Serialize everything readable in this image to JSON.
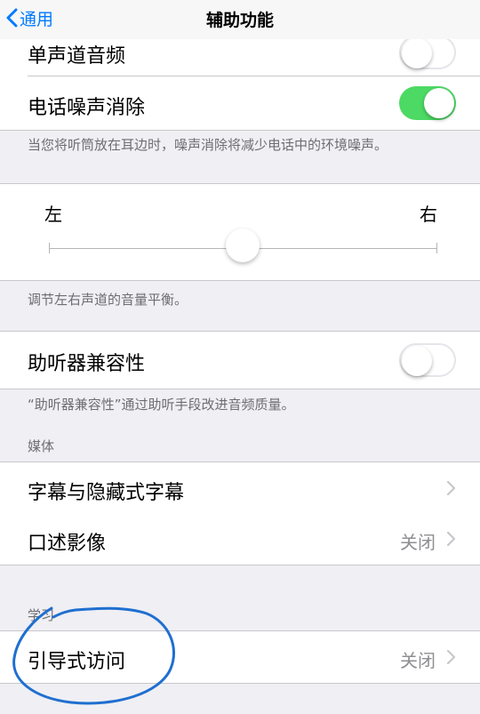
{
  "navbar": {
    "back_label": "通用",
    "title": "辅助功能"
  },
  "rows": {
    "mono_audio": {
      "label": "单声道音频",
      "toggle": "off"
    },
    "phone_noise": {
      "label": "电话噪声消除",
      "toggle": "on"
    },
    "phone_noise_footer": "当您将听筒放在耳边时，噪声消除将减少电话中的环境噪声。",
    "balance": {
      "left": "左",
      "right": "右",
      "value": 0.5,
      "footer": "调节左右声道的音量平衡。"
    },
    "hearing_aid": {
      "label": "助听器兼容性",
      "toggle": "off",
      "footer": "“助听器兼容性”通过助听手段改进音频质量。"
    },
    "media_header": "媒体",
    "subtitles": {
      "label": "字幕与隐藏式字幕"
    },
    "audio_desc": {
      "label": "口述影像",
      "value": "关闭"
    },
    "learning_header": "学习",
    "guided_access": {
      "label": "引导式访问",
      "value": "关闭"
    }
  },
  "colors": {
    "accent": "#007aff",
    "toggle_on": "#4cd964",
    "annotation": "#1f6fd0"
  }
}
